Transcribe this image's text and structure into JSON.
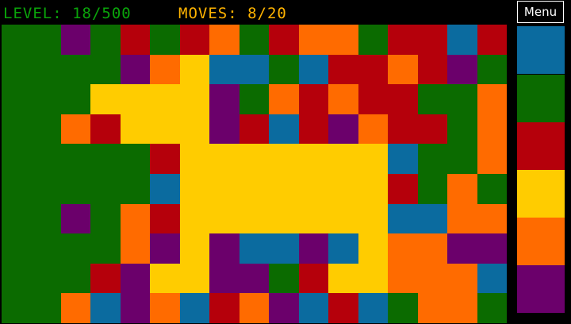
{
  "hud": {
    "level": "LEVEL: 18/500",
    "moves": "MOVES: 8/20"
  },
  "menu_label": "Menu",
  "colors": {
    "G": "#0b6b00",
    "P": "#6b006b",
    "R": "#b5000b",
    "O": "#ff6b00",
    "Y": "#ffcc00",
    "B": "#0b6b9f"
  },
  "palette": [
    {
      "name": "blue",
      "key": "B"
    },
    {
      "name": "green",
      "key": "G"
    },
    {
      "name": "red",
      "key": "R"
    },
    {
      "name": "yellow",
      "key": "Y"
    },
    {
      "name": "orange",
      "key": "O"
    },
    {
      "name": "purple",
      "key": "P"
    }
  ],
  "board": {
    "columns": 17,
    "rows": 10,
    "grid": [
      "GGPGRGROGROOGRRBR",
      "GGGGPOYBBGBRRORPG",
      "GGGYYYYPGORORRGGO",
      "GGORYYYPRBRPORRGO",
      "GGGGGRYYYYYYYBGGO",
      "GGGGGBYYYYYYYRGOG",
      "GGPGORYYYYYYYBBOO",
      "GGGGOPYPBBPBYOOPP",
      "GGGRPYYPPGRYYOOOB",
      "GGOBPOBROPBRBGOOG"
    ]
  }
}
